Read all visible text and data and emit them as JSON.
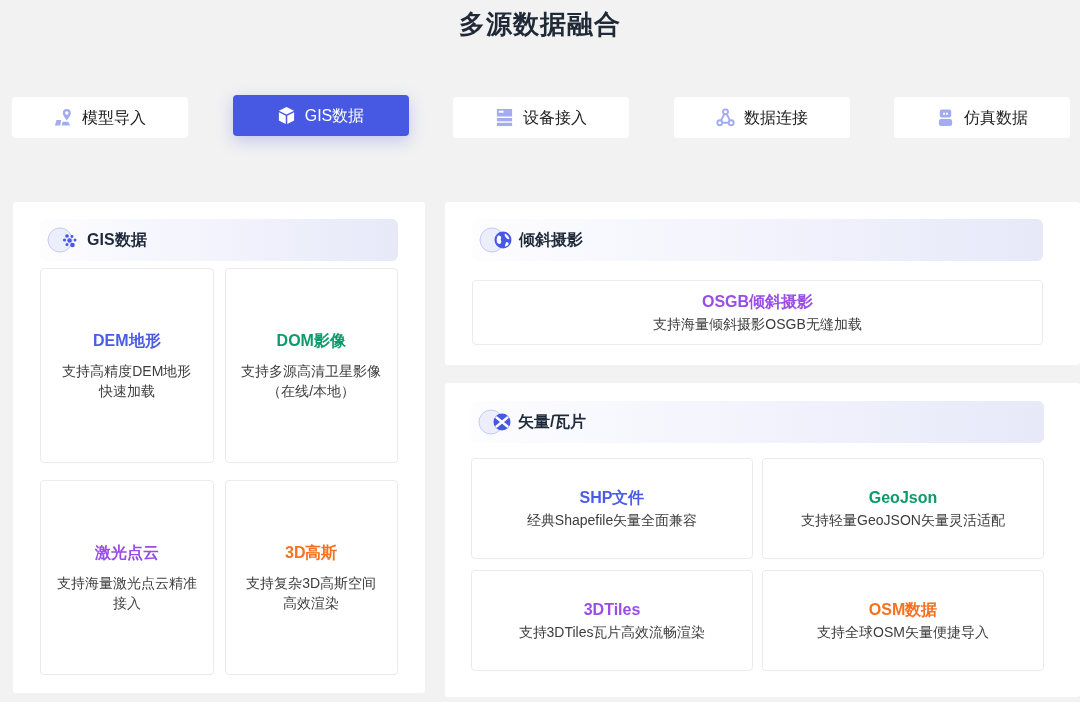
{
  "title": "多源数据融合",
  "tabs": [
    {
      "label": "模型导入",
      "selected": false
    },
    {
      "label": "GIS数据",
      "selected": true
    },
    {
      "label": "设备接入",
      "selected": false
    },
    {
      "label": "数据连接",
      "selected": false
    },
    {
      "label": "仿真数据",
      "selected": false
    }
  ],
  "panels": [
    {
      "title": "GIS数据",
      "cards": [
        {
          "title": "DEM地形",
          "description": "支持高精度DEM地形快速加载",
          "color": "#4a5be6"
        },
        {
          "title": "DOM影像",
          "description": "支持多源高清卫星影像（在线/本地）",
          "color": "#0b9b6b"
        },
        {
          "title": "激光点云",
          "description": "支持海量激光点云精准接入",
          "color": "#9a4de6"
        },
        {
          "title": "3D高斯",
          "description": "支持复杂3D高斯空间高效渲染",
          "color": "#f7711e"
        }
      ]
    },
    {
      "title": "倾斜摄影",
      "cards": [
        {
          "title": "OSGB倾斜摄影",
          "description": "支持海量倾斜摄影OSGB无缝加载",
          "color": "#9a4de6"
        }
      ]
    },
    {
      "title": "矢量/瓦片",
      "cards": [
        {
          "title": "SHP文件",
          "description": "经典Shapefile矢量全面兼容",
          "color": "#4a5be6"
        },
        {
          "title": "GeoJson",
          "description": "支持轻量GeoJSON矢量灵活适配",
          "color": "#0b9b6b"
        },
        {
          "title": "3DTiles",
          "description": "支持3DTiles瓦片高效流畅渲染",
          "color": "#9a4de6"
        },
        {
          "title": "OSM数据",
          "description": "支持全球OSM矢量便捷导入",
          "color": "#f7711e"
        }
      ]
    }
  ]
}
